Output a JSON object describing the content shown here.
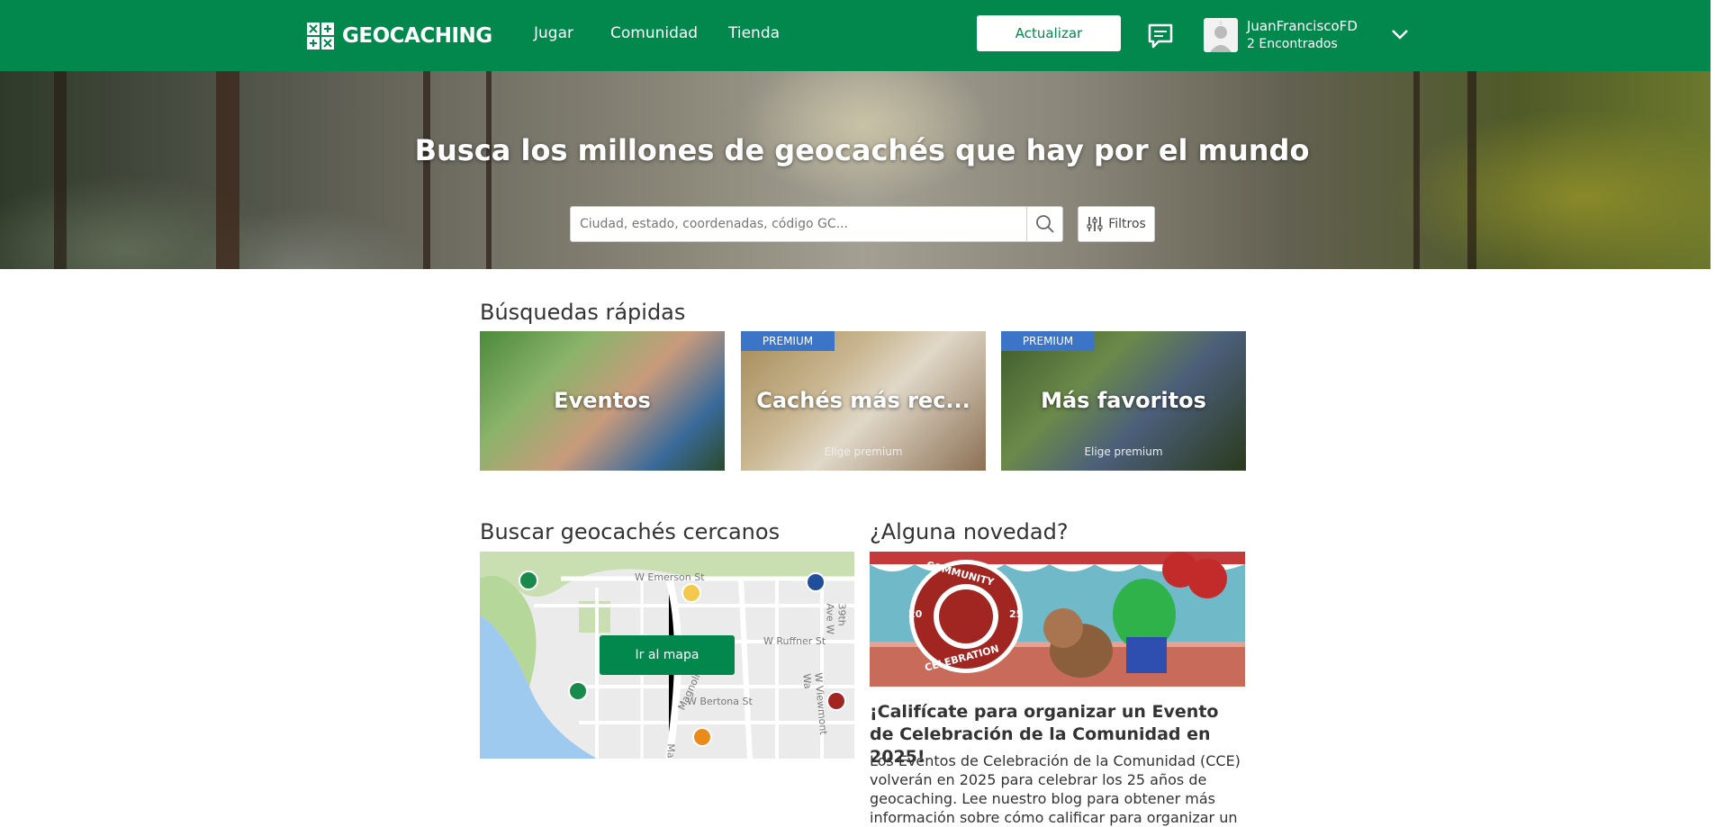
{
  "header": {
    "logo_text": "GEOCACHING",
    "nav": [
      "Jugar",
      "Comunidad",
      "Tienda"
    ],
    "upgrade_label": "Actualizar",
    "user": {
      "name": "JuanFranciscoFD",
      "finds": "2 Encontrados"
    }
  },
  "hero": {
    "title": "Busca los millones de geocachés que hay por el mundo",
    "search_placeholder": "Ciudad, estado, coordenadas, código GC...",
    "filters_label": "Filtros"
  },
  "quick_search": {
    "title": "Búsquedas rápidas",
    "cards": [
      {
        "label": "Eventos",
        "badge": "",
        "sub": ""
      },
      {
        "label": "Cachés más rec...",
        "badge": "PREMIUM",
        "sub": "Elige premium"
      },
      {
        "label": "Más favoritos",
        "badge": "PREMIUM",
        "sub": "Elige premium"
      }
    ]
  },
  "nearby": {
    "title": "Buscar geocachés cercanos",
    "map_button": "Ir al mapa",
    "streets": [
      "W Emerson St",
      "W Ruffner St",
      "W Bertona St",
      "Magnolia Bl",
      "W Viewmont Wa",
      "39th Ave W",
      "Ma"
    ]
  },
  "news": {
    "title": "¿Alguna novedad?",
    "image_text": {
      "top": "COMMUNITY",
      "bottom": "CELEBRATION",
      "left": "20",
      "right": "25"
    },
    "headline": "¡Califícate para organizar un Evento de Celebración de la Comunidad en 2025!",
    "body": "Los Eventos de Celebración de la Comunidad (CCE) volverán en 2025 para celebrar los 25 años de geocaching. Lee nuestro blog para obtener más información sobre cómo calificar para organizar un"
  },
  "colors": {
    "brand_green": "#02874d",
    "premium_blue": "#3c75c7"
  }
}
